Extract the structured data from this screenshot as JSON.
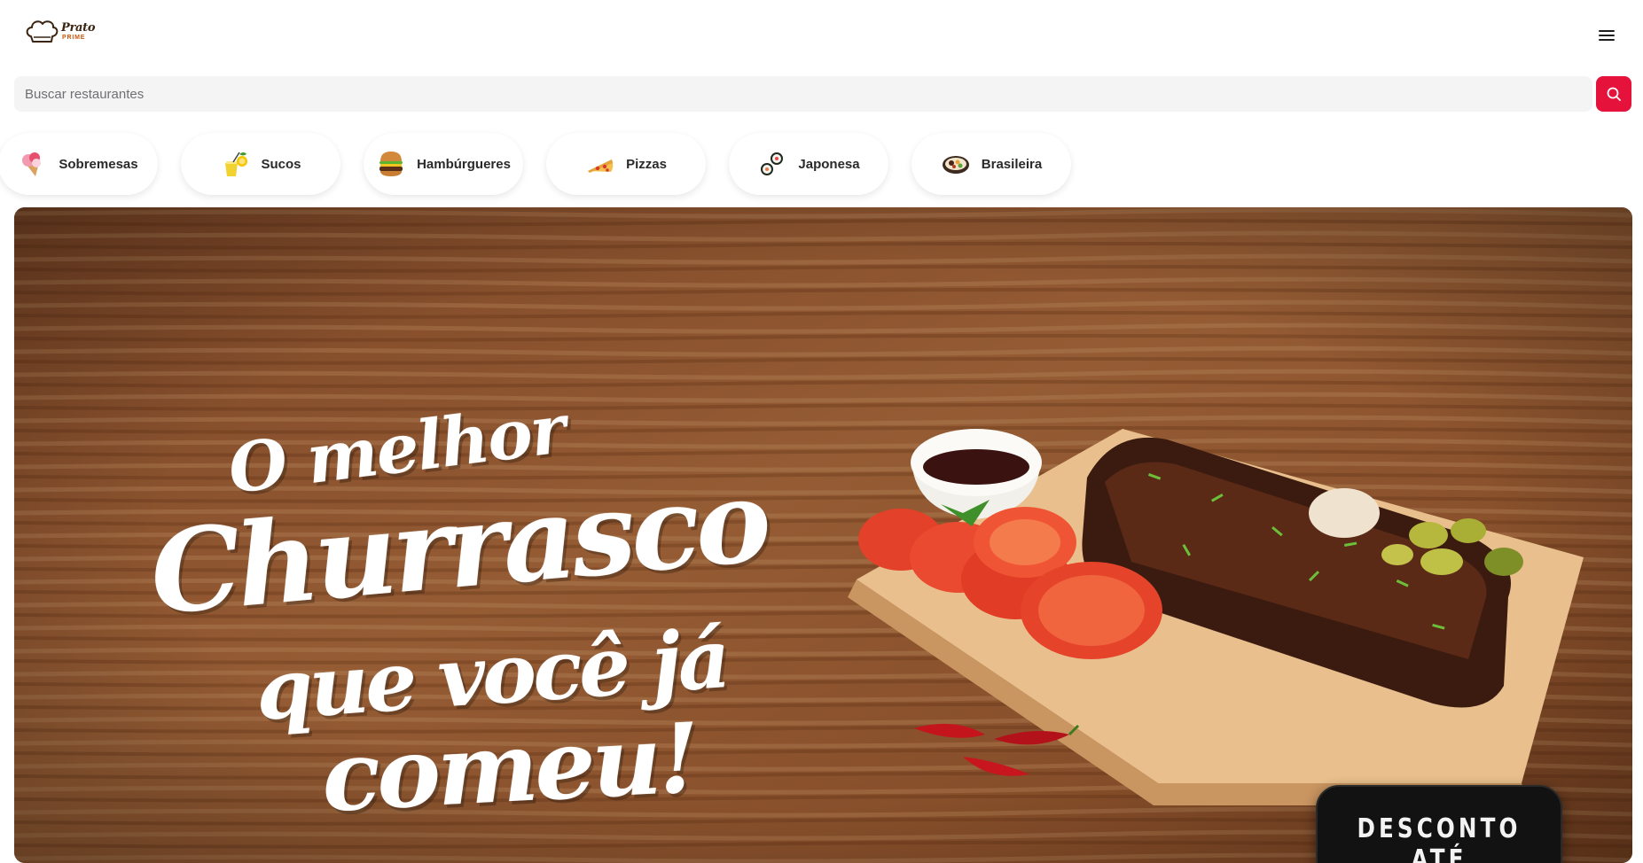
{
  "header": {
    "logo_line1": "Prato",
    "logo_line2": "PRIME"
  },
  "search": {
    "placeholder": "Buscar restaurantes",
    "value": ""
  },
  "categories": [
    {
      "label": "Sobremesas",
      "icon": "ice-cream-icon"
    },
    {
      "label": "Sucos",
      "icon": "juice-icon"
    },
    {
      "label": "Hambúrgueres",
      "icon": "burger-icon"
    },
    {
      "label": "Pizzas",
      "icon": "pizza-icon"
    },
    {
      "label": "Japonesa",
      "icon": "sushi-icon"
    },
    {
      "label": "Brasileira",
      "icon": "feijoada-icon"
    }
  ],
  "banner": {
    "line1": "O melhor",
    "line2": "Churrasco",
    "line3": "que você já",
    "line4": "comeu!",
    "promo_text": "DESCONTO ATÉ"
  },
  "colors": {
    "accent": "#e5123b",
    "wood": "#8a5530",
    "logo_text": "#3a2512",
    "logo_sub": "#c8570f"
  }
}
